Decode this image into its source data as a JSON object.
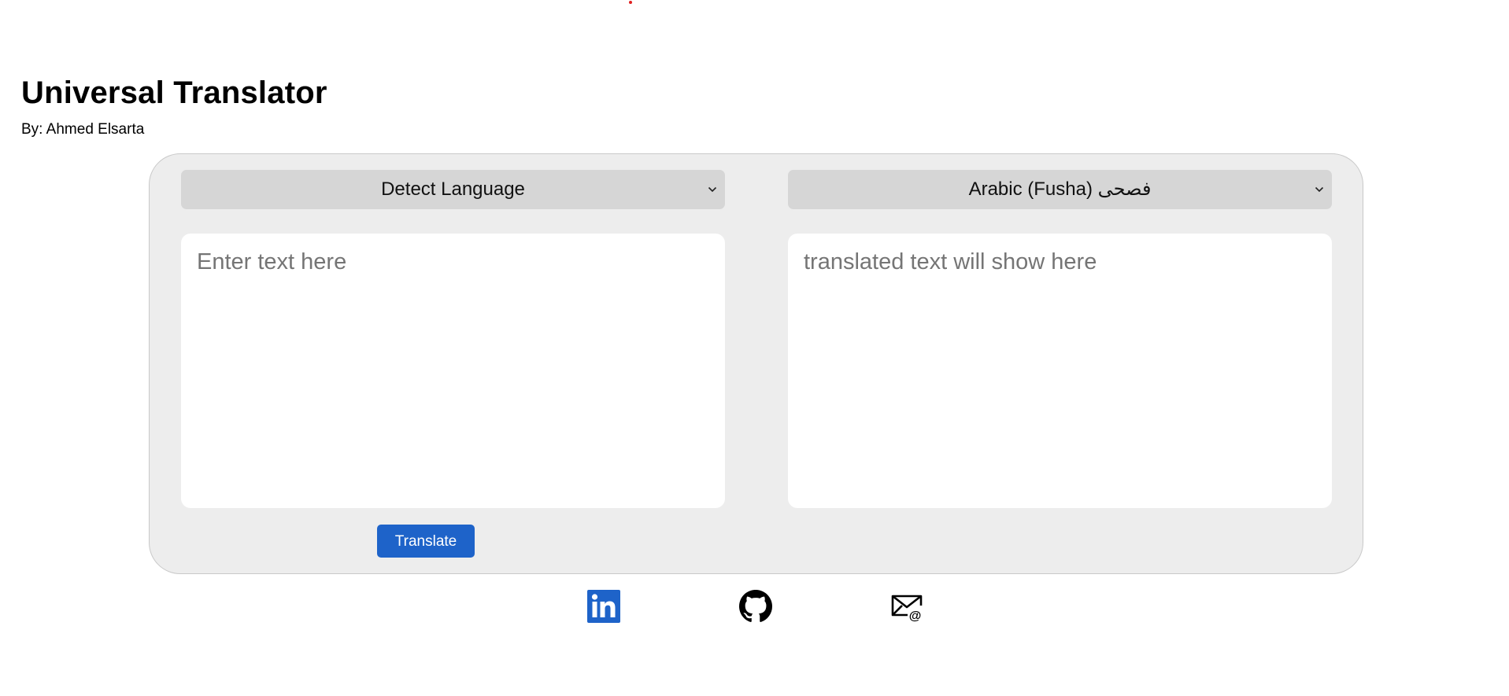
{
  "header": {
    "title": "Universal Translator",
    "byline": "By: Ahmed Elsarta"
  },
  "translator": {
    "source_language": {
      "selected": "Detect Language"
    },
    "target_language": {
      "selected": "Arabic (Fusha) فصحى"
    },
    "input": {
      "placeholder": "Enter text here",
      "value": ""
    },
    "output": {
      "placeholder": "translated text will show here",
      "value": ""
    },
    "translate_button": "Translate"
  },
  "footer": {
    "links": [
      {
        "name": "linkedin",
        "icon": "linkedin-icon"
      },
      {
        "name": "github",
        "icon": "github-icon"
      },
      {
        "name": "email",
        "icon": "email-icon"
      }
    ]
  },
  "colors": {
    "accent": "#1e63c9",
    "panel_background": "#ededed",
    "select_background": "#d6d6d6"
  }
}
